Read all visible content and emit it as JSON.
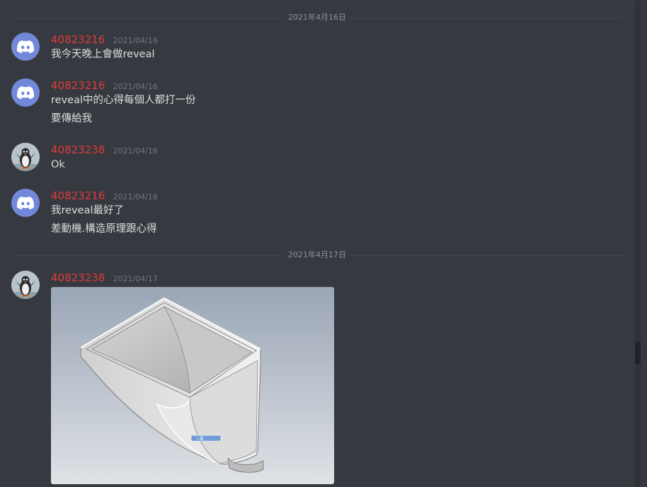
{
  "dividers": [
    "2021年4月16日",
    "2021年4月17日"
  ],
  "messages": [
    {
      "username": "40823216",
      "timestamp": "2021/04/16",
      "avatar": "discord-logo-icon",
      "lines": [
        "我今天晚上會做reveal"
      ]
    },
    {
      "username": "40823216",
      "timestamp": "2021/04/16",
      "avatar": "discord-logo-icon",
      "lines": [
        "reveal中的心得每個人都打一份",
        "要傳給我"
      ]
    },
    {
      "username": "40823238",
      "timestamp": "2021/04/16",
      "avatar": "penguin-photo",
      "lines": [
        "Ok"
      ]
    },
    {
      "username": "40823216",
      "timestamp": "2021/04/16",
      "avatar": "discord-logo-icon",
      "lines": [
        "我reveal最好了",
        "差動機.構造原理跟心得"
      ]
    },
    {
      "username": "40823238",
      "timestamp": "2021/04/17",
      "avatar": "penguin-photo",
      "lines": [],
      "attachment": {
        "type": "image",
        "content": "3D CAD render of a hopper/chute part",
        "label": "i.南"
      }
    }
  ],
  "colors": {
    "background": "#36393f",
    "username": "#e03b3b",
    "timestamp": "#72767d",
    "text": "#dcddde",
    "divider_text": "#8e9297",
    "discord_blurple": "#7289da"
  }
}
